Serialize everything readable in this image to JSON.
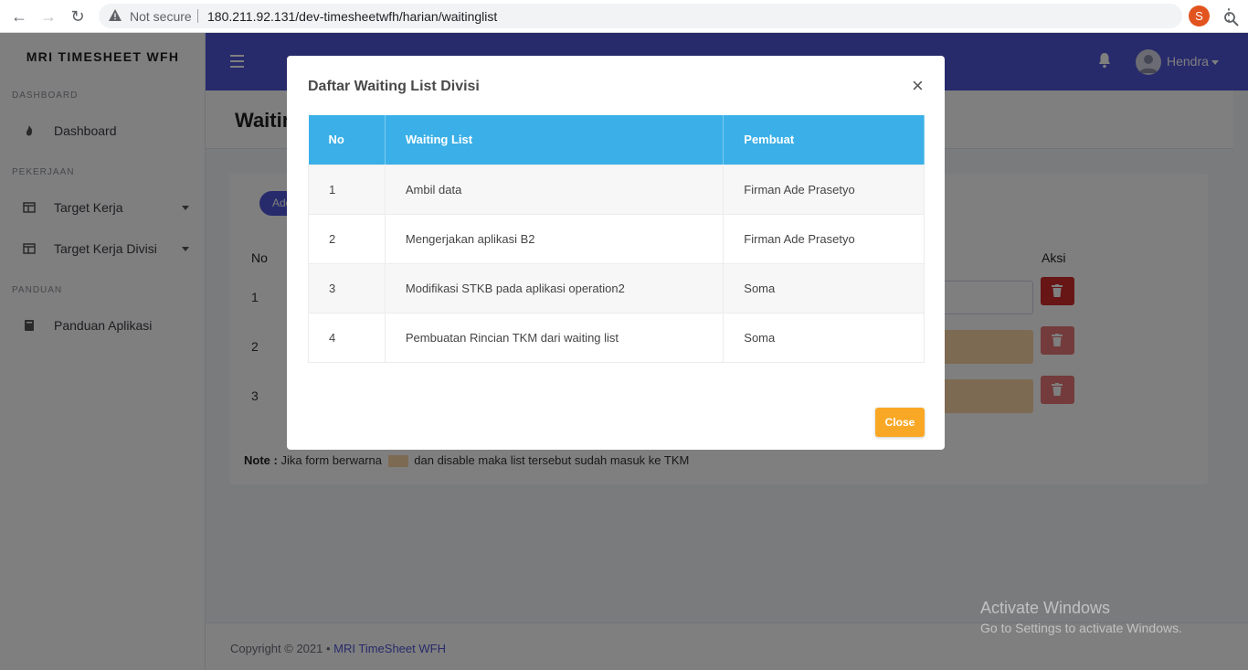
{
  "browser": {
    "security_label": "Not secure",
    "url": "180.211.92.131/dev-timesheetwfh/harian/waitinglist",
    "profile_initial": "S"
  },
  "sidebar": {
    "brand": "MRI TIMESHEET WFH",
    "sections": [
      {
        "heading": "DASHBOARD",
        "items": [
          {
            "label": "Dashboard",
            "icon": "fire-icon"
          }
        ]
      },
      {
        "heading": "PEKERJAAN",
        "items": [
          {
            "label": "Target Kerja",
            "icon": "table-icon",
            "has_caret": true
          },
          {
            "label": "Target Kerja Divisi",
            "icon": "table-icon",
            "has_caret": true
          }
        ]
      },
      {
        "heading": "PANDUAN",
        "items": [
          {
            "label": "Panduan Aplikasi",
            "icon": "book-icon"
          }
        ]
      }
    ]
  },
  "topbar": {
    "user_name": "Hendra"
  },
  "page": {
    "title": "Waiting List Divisi",
    "add_button": "Add",
    "table": {
      "col_no": "No",
      "col_aksi": "Aksi",
      "rows": [
        "1",
        "2",
        "3"
      ]
    },
    "note_bold": "Note :",
    "note_before": "Jika form berwarna",
    "note_after": "dan disable maka list tersebut sudah masuk ke TKM"
  },
  "footer": {
    "copyright": "Copyright © 2021  •",
    "app_link": "MRI TimeSheet WFH"
  },
  "modal": {
    "title": "Daftar Waiting List Divisi",
    "headers": [
      "No",
      "Waiting List",
      "Pembuat"
    ],
    "rows": [
      {
        "no": "1",
        "item": "Ambil data",
        "by": "Firman Ade Prasetyo"
      },
      {
        "no": "2",
        "item": "Mengerjakan aplikasi B2",
        "by": "Firman Ade Prasetyo"
      },
      {
        "no": "3",
        "item": "Modifikasi STKB pada aplikasi operation2",
        "by": "Soma"
      },
      {
        "no": "4",
        "item": "Pembuatan Rincian TKM dari waiting list",
        "by": "Soma"
      }
    ],
    "close_label": "Close"
  },
  "watermark": {
    "line1": "Activate Windows",
    "line2": "Go to Settings to activate Windows."
  },
  "colors": {
    "primary": "#4e55d6",
    "table_header": "#3bb0e8",
    "close_button": "#f9a825",
    "delete_button": "#d12b2b",
    "done_field": "#fbd5a5"
  }
}
